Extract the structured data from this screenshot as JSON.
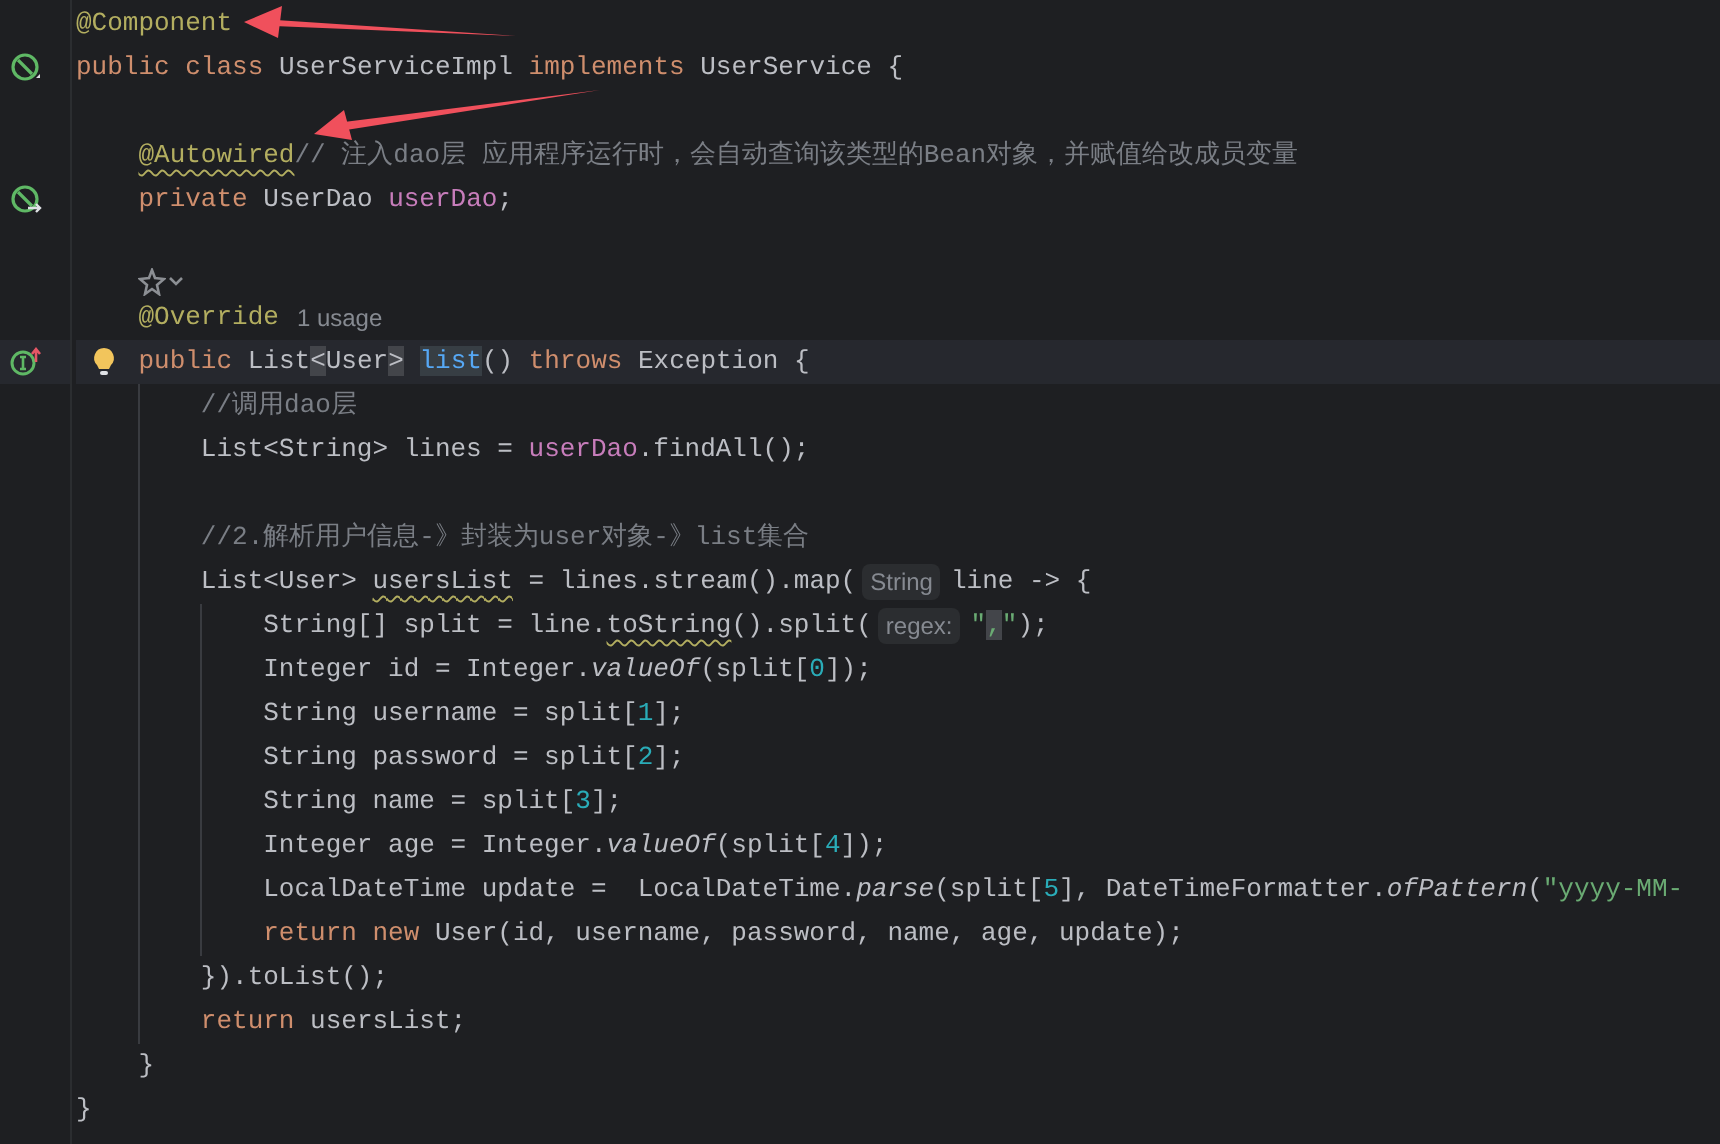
{
  "editor": {
    "lines": [
      {
        "kind": "code",
        "current": false,
        "segments": [
          {
            "kind": "code",
            "tokens": [
              {
                "text": "@Component",
                "kind": "annotation"
              }
            ]
          }
        ]
      },
      {
        "kind": "code",
        "current": false,
        "marker": {
          "kind": "bean"
        },
        "segments": [
          {
            "kind": "code",
            "tokens": [
              {
                "text": "public class ",
                "kind": "keyword"
              },
              {
                "text": "UserServiceImpl ",
                "kind": "plain"
              },
              {
                "text": "implements ",
                "kind": "keyword"
              },
              {
                "text": "UserService {",
                "kind": "plain"
              }
            ]
          }
        ]
      },
      {
        "kind": "blank",
        "current": false
      },
      {
        "kind": "code",
        "current": false,
        "segments": [
          {
            "kind": "code",
            "tokens": [
              {
                "text": "    @Autowired",
                "kind": "annotation-warn"
              },
              {
                "text": "// 注入dao层 应用程序运行时，会自动查询该类型的Bean对象，并赋值给改成员变量",
                "kind": "comment"
              }
            ]
          }
        ]
      },
      {
        "kind": "code",
        "current": false,
        "marker": {
          "kind": "bean-injected"
        },
        "segments": [
          {
            "kind": "code",
            "tokens": [
              {
                "text": "    private ",
                "kind": "keyword"
              },
              {
                "text": "UserDao ",
                "kind": "plain"
              },
              {
                "text": "userDao",
                "kind": "field"
              },
              {
                "text": ";",
                "kind": "plain"
              }
            ]
          }
        ]
      },
      {
        "kind": "blank",
        "current": false
      },
      {
        "kind": "vision",
        "current": false
      },
      {
        "kind": "code",
        "current": false,
        "segments": [
          {
            "kind": "code",
            "tokens": [
              {
                "text": "    @Override",
                "kind": "annotation"
              }
            ]
          },
          {
            "kind": "usage",
            "text": "1 usage"
          }
        ]
      },
      {
        "kind": "code",
        "current": true,
        "marker": {
          "kind": "implements"
        },
        "intention": {
          "kind": "bulb"
        },
        "segments": [
          {
            "kind": "code",
            "tokens": [
              {
                "text": "    public ",
                "kind": "keyword"
              },
              {
                "text": "List",
                "kind": "plain"
              },
              {
                "text": "<",
                "kind": "match"
              },
              {
                "text": "User",
                "kind": "plain"
              },
              {
                "text": "> ",
                "kind": "match"
              },
              {
                "text": "list",
                "kind": "method-match"
              },
              {
                "text": "() ",
                "kind": "plain"
              },
              {
                "text": "throws ",
                "kind": "keyword"
              },
              {
                "text": "Exception {",
                "kind": "plain"
              }
            ]
          }
        ]
      },
      {
        "kind": "code",
        "current": false,
        "segments": [
          {
            "kind": "code",
            "tokens": [
              {
                "text": "        //调用dao层",
                "kind": "comment"
              }
            ]
          }
        ]
      },
      {
        "kind": "code",
        "current": false,
        "segments": [
          {
            "kind": "code",
            "tokens": [
              {
                "text": "        List<String> lines = ",
                "kind": "plain"
              },
              {
                "text": "userDao",
                "kind": "field"
              },
              {
                "text": ".findAll();",
                "kind": "plain"
              }
            ]
          }
        ]
      },
      {
        "kind": "blank",
        "current": false
      },
      {
        "kind": "code",
        "current": false,
        "segments": [
          {
            "kind": "code",
            "tokens": [
              {
                "text": "        //2.解析用户信息-》封装为user对象-》list集合",
                "kind": "comment"
              }
            ]
          }
        ]
      },
      {
        "kind": "code",
        "current": false,
        "segments": [
          {
            "kind": "code",
            "tokens": [
              {
                "text": "        List<User> ",
                "kind": "plain"
              },
              {
                "text": "usersList",
                "kind": "plain-warn"
              },
              {
                "text": " = lines.stream().map(",
                "kind": "plain"
              }
            ]
          },
          {
            "kind": "hint",
            "text": "String"
          },
          {
            "kind": "code",
            "tokens": [
              {
                "text": "line -> {",
                "kind": "plain"
              }
            ]
          }
        ]
      },
      {
        "kind": "code",
        "current": false,
        "segments": [
          {
            "kind": "code",
            "tokens": [
              {
                "text": "            String[] split = line.",
                "kind": "plain"
              },
              {
                "text": "toString",
                "kind": "plain-warn"
              },
              {
                "text": "().split(",
                "kind": "plain"
              }
            ]
          },
          {
            "kind": "hint",
            "text": "regex:"
          },
          {
            "kind": "code",
            "tokens": [
              {
                "text": "\"",
                "kind": "string"
              },
              {
                "text": ",",
                "kind": "string-match"
              },
              {
                "text": "\"",
                "kind": "string"
              },
              {
                "text": ");",
                "kind": "plain"
              }
            ]
          }
        ]
      },
      {
        "kind": "code",
        "current": false,
        "segments": [
          {
            "kind": "code",
            "tokens": [
              {
                "text": "            Integer id = Integer.",
                "kind": "plain"
              },
              {
                "text": "valueOf",
                "kind": "static"
              },
              {
                "text": "(split[",
                "kind": "plain"
              },
              {
                "text": "0",
                "kind": "number"
              },
              {
                "text": "]);",
                "kind": "plain"
              }
            ]
          }
        ]
      },
      {
        "kind": "code",
        "current": false,
        "segments": [
          {
            "kind": "code",
            "tokens": [
              {
                "text": "            String username = split[",
                "kind": "plain"
              },
              {
                "text": "1",
                "kind": "number"
              },
              {
                "text": "];",
                "kind": "plain"
              }
            ]
          }
        ]
      },
      {
        "kind": "code",
        "current": false,
        "segments": [
          {
            "kind": "code",
            "tokens": [
              {
                "text": "            String password = split[",
                "kind": "plain"
              },
              {
                "text": "2",
                "kind": "number"
              },
              {
                "text": "];",
                "kind": "plain"
              }
            ]
          }
        ]
      },
      {
        "kind": "code",
        "current": false,
        "segments": [
          {
            "kind": "code",
            "tokens": [
              {
                "text": "            String name = split[",
                "kind": "plain"
              },
              {
                "text": "3",
                "kind": "number"
              },
              {
                "text": "];",
                "kind": "plain"
              }
            ]
          }
        ]
      },
      {
        "kind": "code",
        "current": false,
        "segments": [
          {
            "kind": "code",
            "tokens": [
              {
                "text": "            Integer age = Integer.",
                "kind": "plain"
              },
              {
                "text": "valueOf",
                "kind": "static"
              },
              {
                "text": "(split[",
                "kind": "plain"
              },
              {
                "text": "4",
                "kind": "number"
              },
              {
                "text": "]);",
                "kind": "plain"
              }
            ]
          }
        ]
      },
      {
        "kind": "code",
        "current": false,
        "segments": [
          {
            "kind": "code",
            "tokens": [
              {
                "text": "            LocalDateTime update =  LocalDateTime.",
                "kind": "plain"
              },
              {
                "text": "parse",
                "kind": "static"
              },
              {
                "text": "(split[",
                "kind": "plain"
              },
              {
                "text": "5",
                "kind": "number"
              },
              {
                "text": "], DateTimeFormatter.",
                "kind": "plain"
              },
              {
                "text": "ofPattern",
                "kind": "static"
              },
              {
                "text": "(",
                "kind": "plain"
              },
              {
                "text": "\"yyyy-MM-",
                "kind": "string"
              }
            ]
          }
        ]
      },
      {
        "kind": "code",
        "current": false,
        "segments": [
          {
            "kind": "code",
            "tokens": [
              {
                "text": "            return new ",
                "kind": "keyword"
              },
              {
                "text": "User(id, username, password, name, age, update);",
                "kind": "plain"
              }
            ]
          }
        ]
      },
      {
        "kind": "code",
        "current": false,
        "segments": [
          {
            "kind": "code",
            "tokens": [
              {
                "text": "        }).toList();",
                "kind": "plain"
              }
            ]
          }
        ]
      },
      {
        "kind": "code",
        "current": false,
        "segments": [
          {
            "kind": "code",
            "tokens": [
              {
                "text": "        return ",
                "kind": "keyword"
              },
              {
                "text": "usersList;",
                "kind": "plain"
              }
            ]
          }
        ]
      },
      {
        "kind": "code",
        "current": false,
        "segments": [
          {
            "kind": "code",
            "tokens": [
              {
                "text": "    }",
                "kind": "plain"
              }
            ]
          }
        ]
      },
      {
        "kind": "code",
        "current": false,
        "segments": [
          {
            "kind": "code",
            "tokens": [
              {
                "text": "}",
                "kind": "plain"
              }
            ]
          }
        ]
      }
    ]
  }
}
